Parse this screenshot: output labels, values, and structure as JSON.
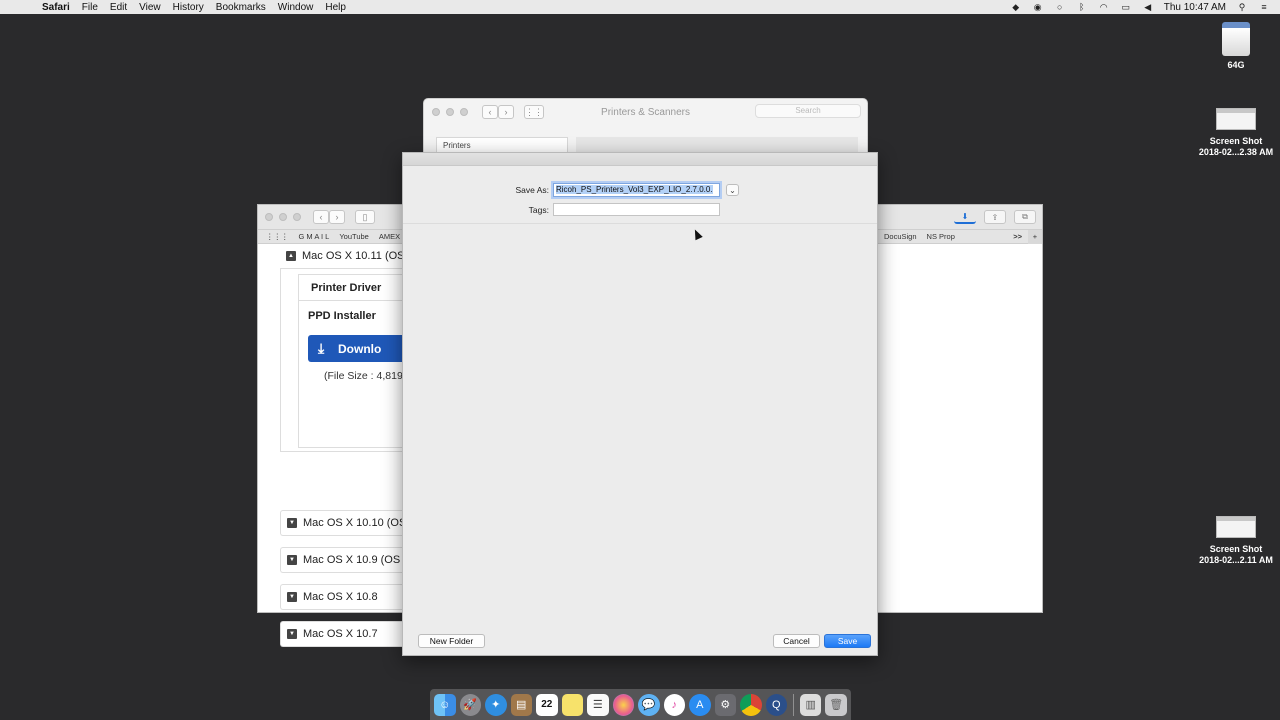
{
  "menubar": {
    "app": "Safari",
    "items": [
      "File",
      "Edit",
      "View",
      "History",
      "Bookmarks",
      "Window",
      "Help"
    ],
    "clock": "Thu 10:47 AM"
  },
  "desktop": {
    "disk_label": "64G",
    "screenshot1": {
      "line1": "Screen Shot",
      "line2": "2018-02...2.38 AM"
    },
    "screenshot2": {
      "line1": "Screen Shot",
      "line2": "2018-02...2.11 AM"
    }
  },
  "printers_window": {
    "title": "Printers & Scanners",
    "search_placeholder": "Search",
    "list_header": "Printers"
  },
  "safari": {
    "favorites": [
      "G M A I L",
      "YouTube",
      "AMEX"
    ],
    "favorites_right": [
      "DocuSign",
      "NS Prop"
    ],
    "overflow": ">>",
    "os_top": "Mac OS X 10.11 (OS",
    "tab_label": "Printer Driver",
    "ppd_label": "PPD Installer",
    "download_label": "Downlo",
    "file_size": "(File Size : 4,819",
    "os_rows": [
      "Mac OS X 10.10 (OS",
      "Mac OS X 10.9 (OS X",
      "Mac OS X 10.8",
      "Mac OS X 10.7"
    ]
  },
  "save_dialog": {
    "save_as_label": "Save As:",
    "filename": "Ricoh_PS_Printers_Vol3_EXP_LIO_2.7.0.0.",
    "tags_label": "Tags:",
    "new_folder": "New Folder",
    "cancel": "Cancel",
    "save": "Save"
  },
  "dock": {
    "calendar_day": "22",
    "icons": [
      "finder-icon",
      "launchpad-icon",
      "safari-icon",
      "notes-icon",
      "calendar-icon",
      "stickies-icon",
      "reminders-icon",
      "photos-icon",
      "messages-icon",
      "itunes-icon",
      "app-store-icon",
      "system-preferences-icon",
      "chrome-icon",
      "quicktime-icon",
      "documents-icon",
      "trash-icon"
    ]
  }
}
